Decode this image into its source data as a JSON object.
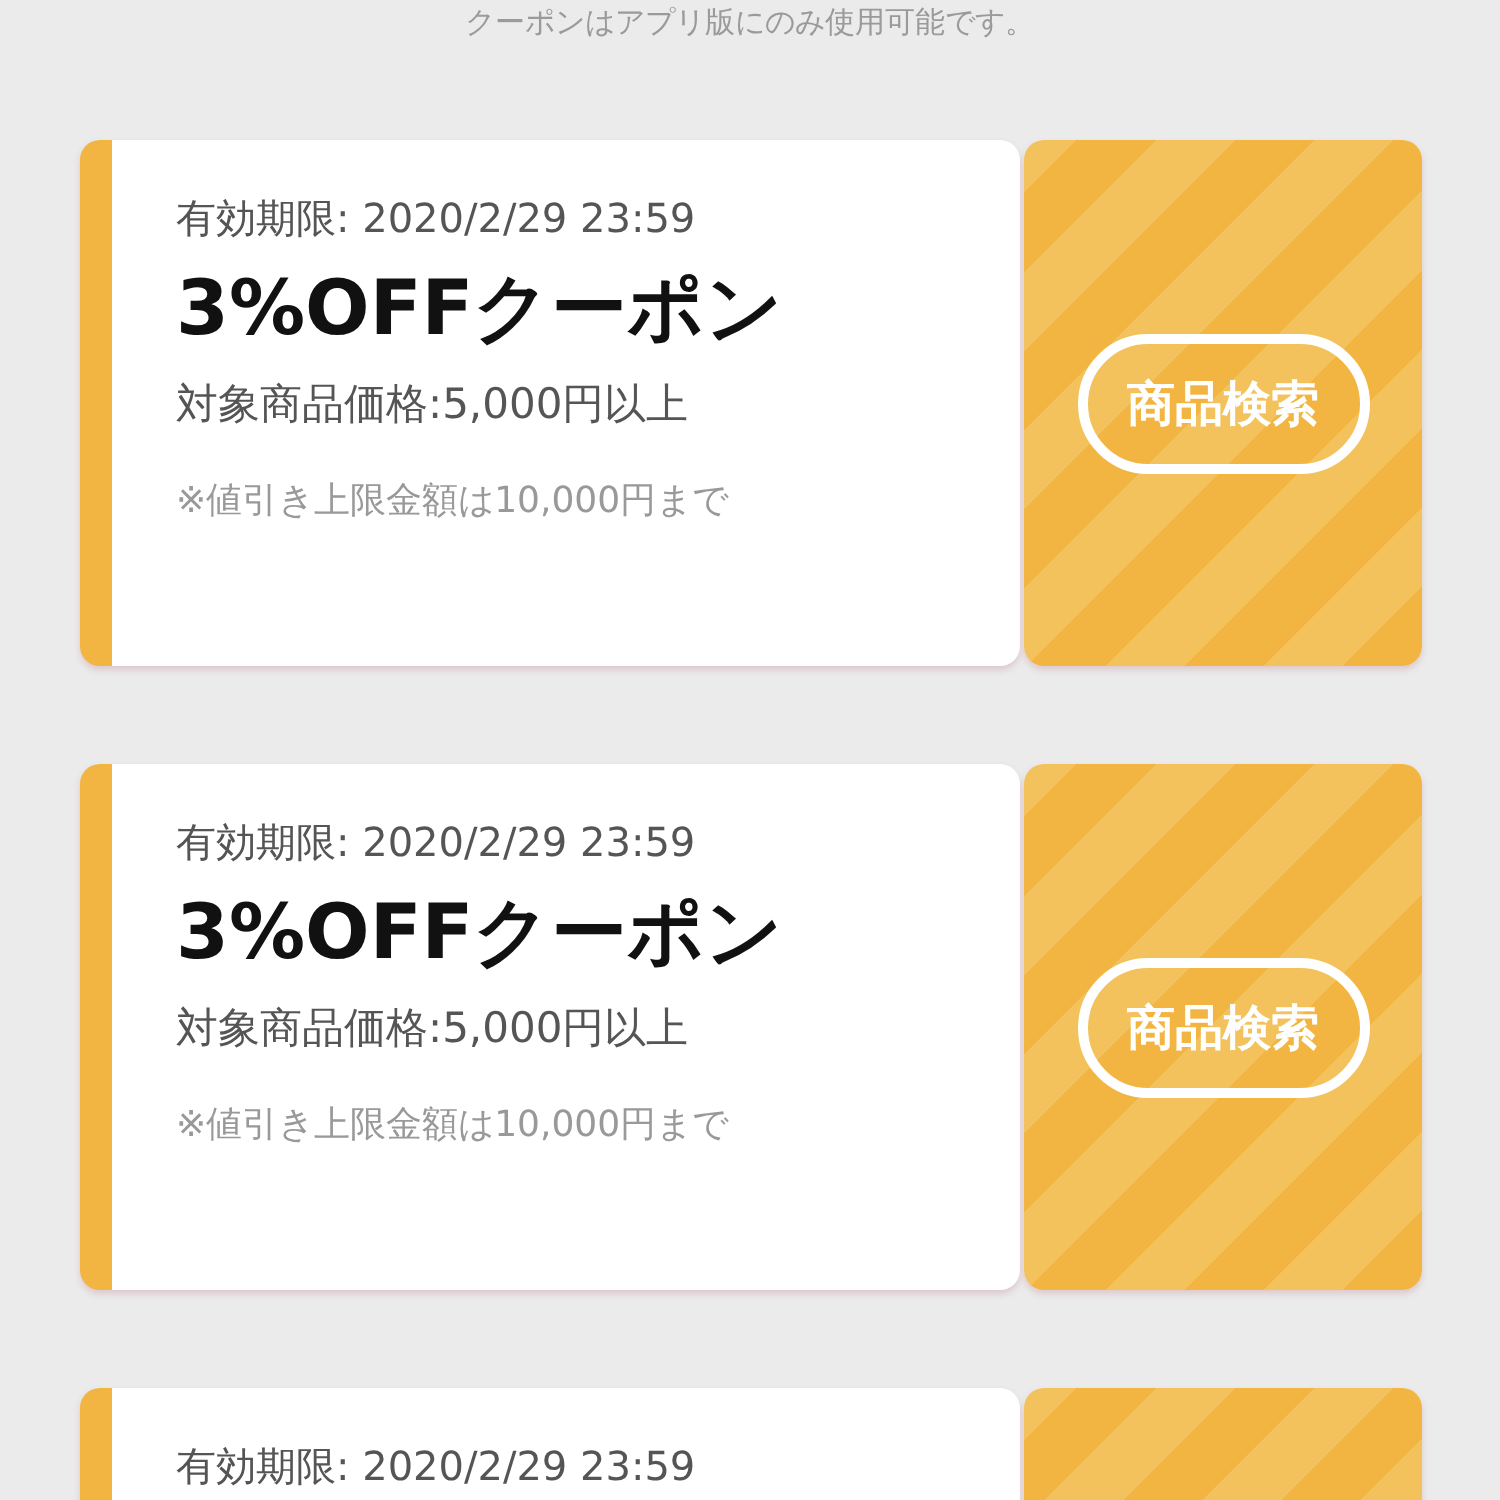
{
  "notice": "クーポンはアプリ版にのみ使用可能です。",
  "coupons": [
    {
      "expiry": "有効期限: 2020/2/29 23:59",
      "title": "3%OFFクーポン",
      "condition": "対象商品価格:5,000円以上",
      "note": "※値引き上限金額は10,000円まで",
      "button": "商品検索"
    },
    {
      "expiry": "有効期限: 2020/2/29 23:59",
      "title": "3%OFFクーポン",
      "condition": "対象商品価格:5,000円以上",
      "note": "※値引き上限金額は10,000円まで",
      "button": "商品検索"
    },
    {
      "expiry": "有効期限: 2020/2/29 23:59"
    }
  ]
}
